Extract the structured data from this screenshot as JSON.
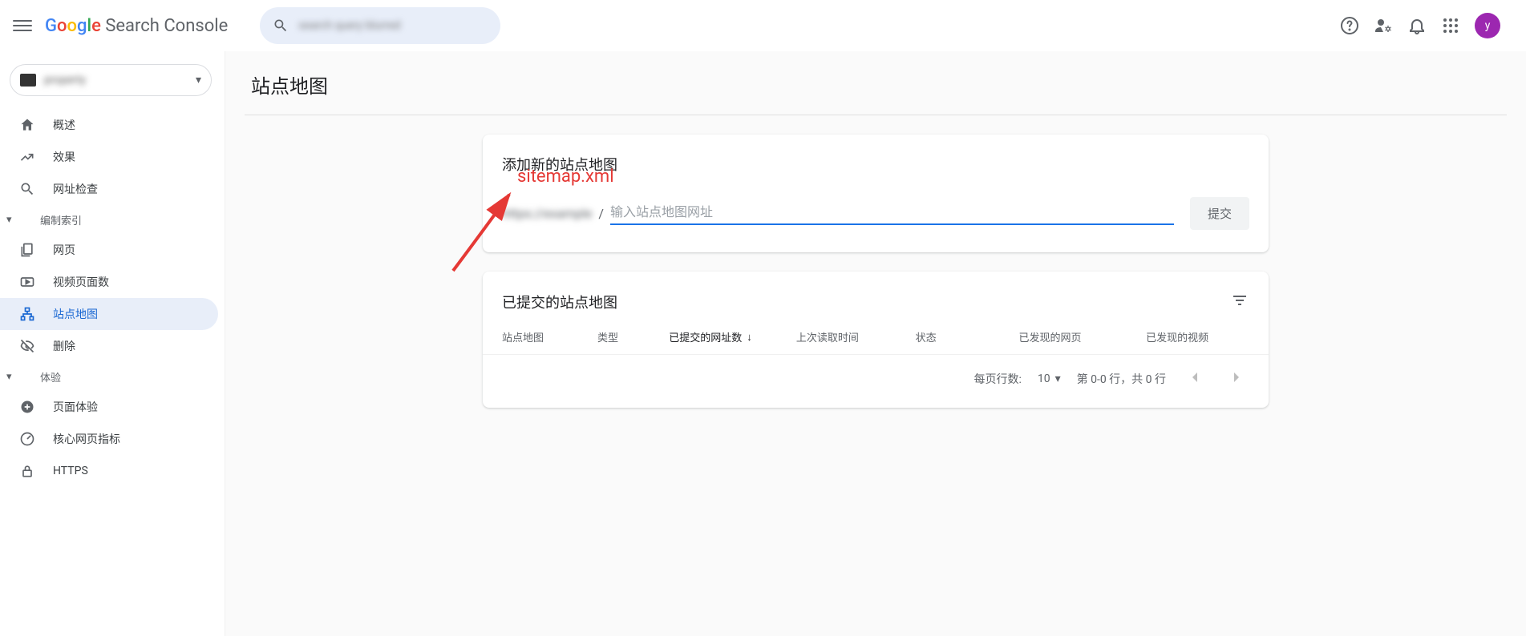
{
  "app": {
    "name": "Search Console"
  },
  "header": {
    "avatar_letter": "y"
  },
  "property": {
    "label": "property"
  },
  "sidebar": {
    "overview": "概述",
    "performance": "效果",
    "url_inspection": "网址检查",
    "index_header": "编制索引",
    "pages": "网页",
    "video_pages": "视频页面数",
    "sitemaps": "站点地图",
    "removals": "删除",
    "experience_header": "体验",
    "page_experience": "页面体验",
    "core_web_vitals": "核心网页指标",
    "https": "HTTPS"
  },
  "page": {
    "title": "站点地图"
  },
  "add_card": {
    "title": "添加新的站点地图",
    "prefix": "https://example",
    "placeholder": "输入站点地图网址",
    "submit": "提交"
  },
  "annotation": {
    "text": "sitemap.xml"
  },
  "submitted_card": {
    "title": "已提交的站点地图",
    "th_sitemap": "站点地图",
    "th_type": "类型",
    "th_submitted": "已提交的网址数",
    "th_last_read": "上次读取时间",
    "th_status": "状态",
    "th_discovered_urls": "已发现的网页",
    "th_discovered_videos": "已发现的视频",
    "rows_per_page_label": "每页行数:",
    "rows_per_page_value": "10",
    "range_text": "第 0-0 行，共 0 行"
  }
}
